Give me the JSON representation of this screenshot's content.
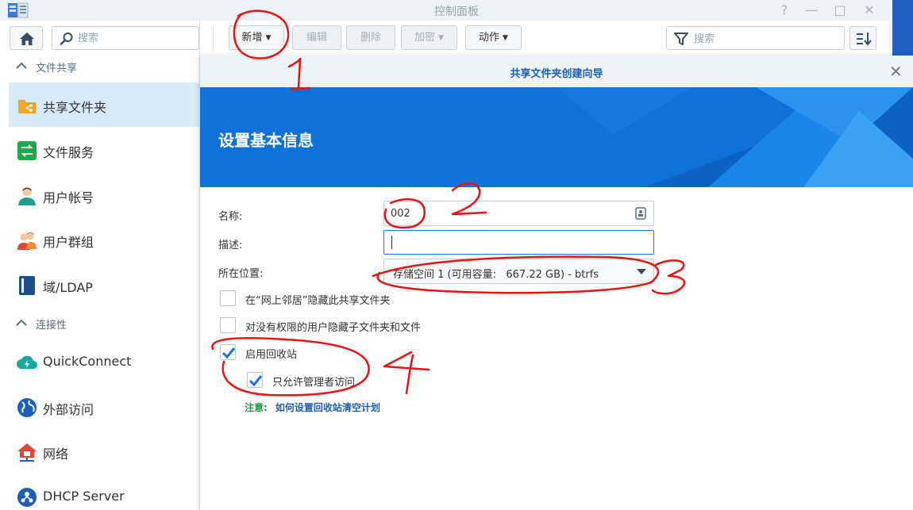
{
  "window": {
    "title": "控制面板",
    "controls": {
      "help": "?",
      "minimize": "—",
      "maximize": "□",
      "close": "✕"
    }
  },
  "sidebar": {
    "search_placeholder": "搜索",
    "sections": [
      {
        "label": "文件共享"
      },
      {
        "label": "连接性"
      }
    ],
    "items": [
      {
        "label": "共享文件夹",
        "icon": "shared-folder-icon",
        "active": true
      },
      {
        "label": "文件服务",
        "icon": "file-services-icon"
      },
      {
        "label": "用户帐号",
        "icon": "user-icon"
      },
      {
        "label": "用户群组",
        "icon": "group-icon"
      },
      {
        "label": "域/LDAP",
        "icon": "domain-ldap-icon"
      },
      {
        "label": "QuickConnect",
        "icon": "quickconnect-icon"
      },
      {
        "label": "外部访问",
        "icon": "external-access-icon"
      },
      {
        "label": "网络",
        "icon": "network-icon"
      },
      {
        "label": "DHCP Server",
        "icon": "dhcp-server-icon"
      }
    ]
  },
  "toolbar": {
    "create_label": "新增",
    "edit_label": "编辑",
    "delete_label": "删除",
    "encrypt_label": "加密",
    "action_label": "动作",
    "filter_placeholder": "搜索"
  },
  "wizard": {
    "title": "共享文件夹创建向导",
    "heading": "设置基本信息",
    "form": {
      "name_label": "名称:",
      "name_value": "002",
      "description_label": "描述:",
      "description_value": "",
      "location_label": "所在位置:",
      "location_value": "存储空间 1 (可用容量:   667.22 GB) - btrfs"
    },
    "options": {
      "hide_network": {
        "label": "在“网上邻居”隐藏此共享文件夹",
        "checked": false
      },
      "hide_subfolders": {
        "label": "对没有权限的用户隐藏子文件夹和文件",
        "checked": false
      },
      "recycle_bin": {
        "label": "启用回收站",
        "checked": true
      },
      "admin_only": {
        "label": "只允许管理者访问",
        "checked": true
      }
    },
    "note_label": "注意:",
    "note_link": "如何设置回收站清空计划"
  },
  "annotations": {
    "color": "#ee1111",
    "marks": [
      "1",
      "2",
      "3",
      "4"
    ]
  },
  "colors": {
    "accent": "#1a5fb4",
    "banner": "#0f72d9",
    "active_item": "#d6ebfa",
    "note_green": "#1e9b44",
    "checkmark": "#1a73e8"
  }
}
